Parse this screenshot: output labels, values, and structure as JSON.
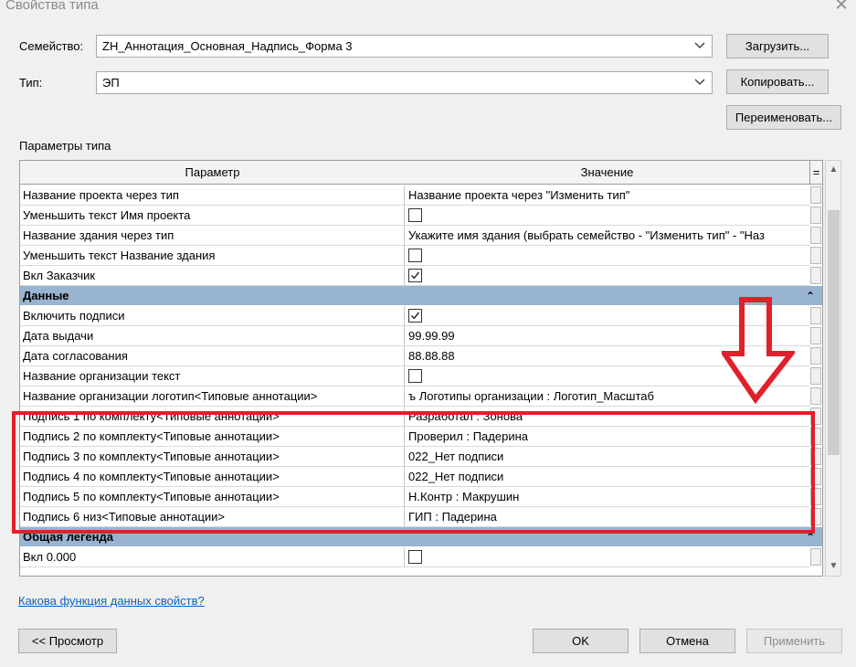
{
  "window": {
    "title": "Свойства типа",
    "close_glyph": "✕"
  },
  "family": {
    "label": "Семейство:",
    "value": "ZH_Аннотация_Основная_Надпись_Форма 3"
  },
  "type": {
    "label": "Тип:",
    "value": "ЭП"
  },
  "buttons": {
    "load": "Загрузить...",
    "copy": "Копировать...",
    "rename": "Переименовать...",
    "preview": "<< Просмотр",
    "ok": "OK",
    "cancel": "Отмена",
    "apply": "Применить"
  },
  "type_params_label": "Параметры типа",
  "grid": {
    "col_param": "Параметр",
    "col_value": "Значение",
    "col_filter": "=",
    "rows": [
      {
        "kind": "row",
        "param": "Название проекта через тип",
        "value": "Название проекта через \"Изменить тип\""
      },
      {
        "kind": "row",
        "param": "Уменьшить текст Имя проекта",
        "checkbox": true,
        "checked": false
      },
      {
        "kind": "row",
        "param": "Название здания через тип",
        "value": "Укажите имя здания (выбрать семейство - \"Изменить тип\" - \"Наз"
      },
      {
        "kind": "row",
        "param": "Уменьшить текст Название здания",
        "checkbox": true,
        "checked": false
      },
      {
        "kind": "row",
        "param": "Вкл Заказчик",
        "checkbox": true,
        "checked": true
      },
      {
        "kind": "group",
        "param": "Данные",
        "collapse": "⌃"
      },
      {
        "kind": "row",
        "param": "Включить подписи",
        "checkbox": true,
        "checked": true
      },
      {
        "kind": "row",
        "param": "Дата выдачи",
        "value": "99.99.99"
      },
      {
        "kind": "row",
        "param": "Дата согласования",
        "value": "88.88.88"
      },
      {
        "kind": "row",
        "param": "Название организации текст",
        "checkbox": true,
        "checked": false
      },
      {
        "kind": "row",
        "param": "Название организации логотип<Типовые аннотации>",
        "value": "ъ Логотипы организации : Логотип_Масштаб"
      },
      {
        "kind": "row",
        "param": "Подпись 1 по комплекту<Типовые аннотации>",
        "value": "Разработал : Зонова"
      },
      {
        "kind": "row",
        "param": "Подпись 2 по комплекту<Типовые аннотации>",
        "value": "Проверил : Падерина"
      },
      {
        "kind": "row",
        "param": "Подпись 3 по комплекту<Типовые аннотации>",
        "value": "022_Нет подписи"
      },
      {
        "kind": "row",
        "param": "Подпись 4 по комплекту<Типовые аннотации>",
        "value": "022_Нет подписи"
      },
      {
        "kind": "row",
        "param": "Подпись 5 по комплекту<Типовые аннотации>",
        "value": "Н.Контр : Макрушин"
      },
      {
        "kind": "row",
        "param": "Подпись 6 низ<Типовые аннотации>",
        "value": "ГИП : Падерина"
      },
      {
        "kind": "group",
        "param": "Общая легенда",
        "collapse": "⌃"
      },
      {
        "kind": "row",
        "param": "Вкл 0.000",
        "checkbox": true,
        "checked": false
      }
    ]
  },
  "help_link": "Какова функция данных свойств?",
  "annotation_color": "#e0202a"
}
